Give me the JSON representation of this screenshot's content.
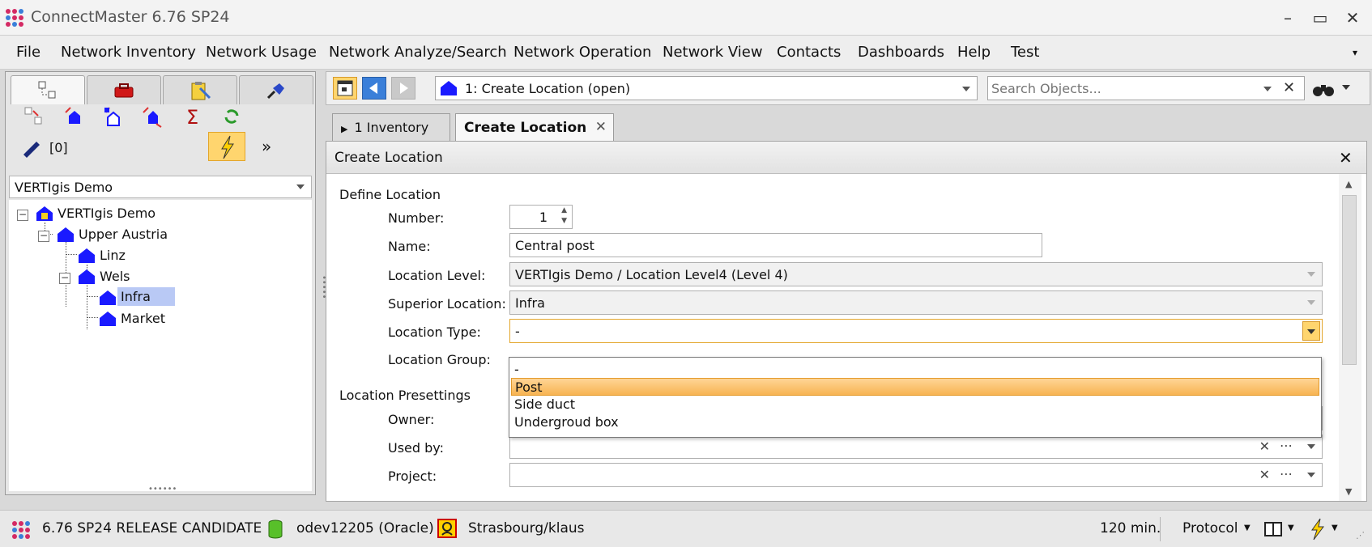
{
  "window": {
    "title": "ConnectMaster 6.76 SP24",
    "minimize": "–",
    "maximize": "▭",
    "close": "✕"
  },
  "menu": [
    "File",
    "Network Inventory",
    "Network Usage",
    "Network Analyze/Search",
    "Network Operation",
    "Network View",
    "Contacts",
    "Dashboards",
    "Help",
    "Test"
  ],
  "left": {
    "filter_count": "[0]",
    "more": "»",
    "combo_value": "VERTIgis Demo",
    "tree": [
      {
        "label": "VERTIgis Demo"
      },
      {
        "label": "Upper Austria"
      },
      {
        "label": "Linz"
      },
      {
        "label": "Wels"
      },
      {
        "label": "Infra"
      },
      {
        "label": "Market"
      }
    ]
  },
  "toolbar": {
    "location_combo": "1: Create Location  (open)",
    "search_placeholder": "Search Objects..."
  },
  "tabs": [
    {
      "label": "1 Inventory"
    },
    {
      "label": "Create Location"
    }
  ],
  "panel": {
    "title": "Create Location",
    "section_define": "Define Location",
    "section_presettings": "Location Presettings",
    "fields": {
      "number_label": "Number:",
      "number_value": "1",
      "name_label": "Name:",
      "name_value": "Central post",
      "level_label": "Location Level:",
      "level_value": "VERTIgis Demo / Location Level4 (Level 4)",
      "superior_label": "Superior Location:",
      "superior_value": "Infra",
      "type_label": "Location Type:",
      "type_value": "-",
      "group_label": "Location Group:",
      "owner_label": "Owner:",
      "usedby_label": "Used by:",
      "project_label": "Project:"
    },
    "type_options": [
      "-",
      "Post",
      "Side duct",
      "Undergroud box"
    ],
    "selected_option": "Post"
  },
  "status": {
    "version": "6.76 SP24 RELEASE CANDIDATE",
    "database": "odev12205 (Oracle)",
    "user": "Strasbourg/klaus",
    "timeout": "120 min.",
    "protocol": "Protocol"
  },
  "colors": {
    "accent_orange": "#f7b452",
    "house_blue": "#1a1aff",
    "selection_blue": "#b9c9f5"
  }
}
